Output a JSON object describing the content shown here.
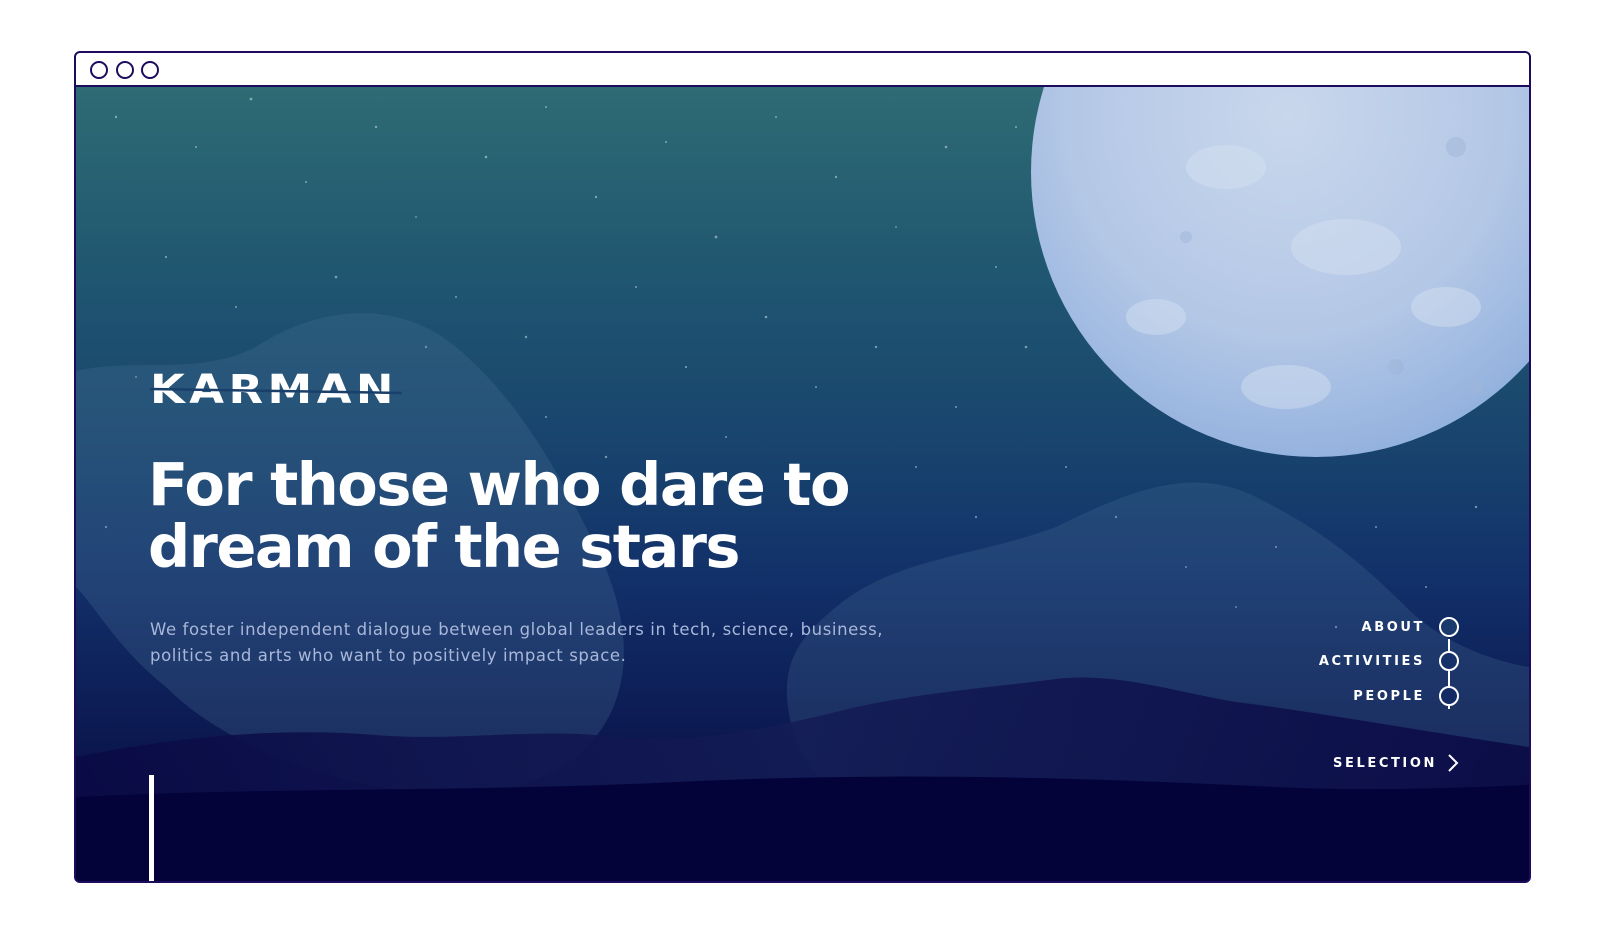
{
  "brand": {
    "logo_text": "KARMAN"
  },
  "hero": {
    "headline": "For those who dare to dream of the stars",
    "subtitle": "We foster independent dialogue between global leaders in tech, science, business, politics and arts who want to positively impact space."
  },
  "side_nav": {
    "items": [
      {
        "label": "ABOUT",
        "icon": "circle-outline-icon"
      },
      {
        "label": "ACTIVITIES",
        "icon": "circle-outline-icon"
      },
      {
        "label": "PEOPLE",
        "icon": "circle-outline-icon"
      }
    ]
  },
  "selection": {
    "label": "SELECTION",
    "icon": "chevron-right-icon"
  },
  "colors": {
    "window_border": "#1d0b5e",
    "sky_top": "#2e6b74",
    "sky_bottom": "#05053a",
    "moon": "#b9cbe6",
    "text_white": "#ffffff",
    "subtitle_text": "#a9b7d9"
  }
}
